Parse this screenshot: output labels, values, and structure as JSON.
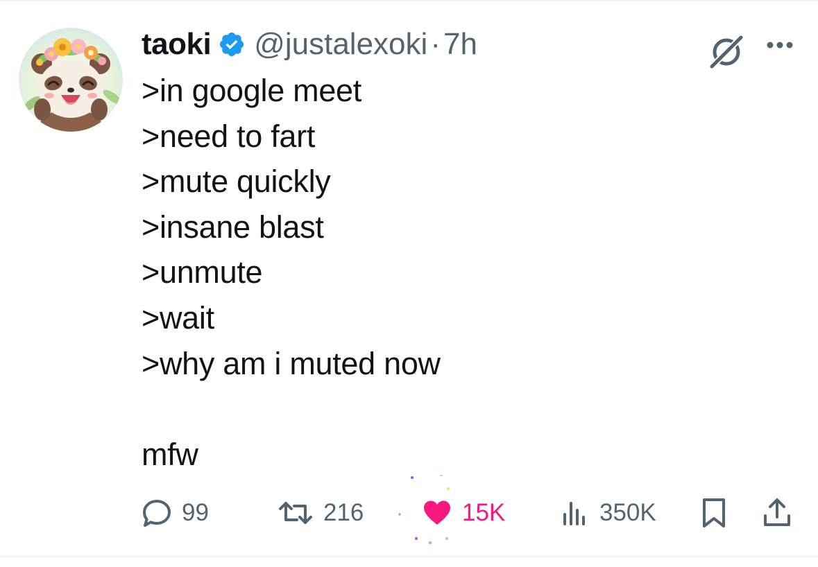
{
  "tweet": {
    "author": {
      "display_name": "taoki",
      "handle": "@justalexoki",
      "verified": true,
      "avatar_icon": "panda-flower-crown-avatar"
    },
    "separator": "·",
    "time": "7h",
    "text_lines": [
      ">in google meet",
      ">need to fart",
      ">mute quickly",
      ">insane blast",
      ">unmute",
      ">wait",
      ">why am i muted now"
    ],
    "closing_line": "mfw",
    "actions": {
      "replies": "99",
      "reposts": "216",
      "likes": "15K",
      "views": "350K"
    },
    "liked": true,
    "icons": [
      "grok-icon",
      "more-icon",
      "reply-icon",
      "repost-icon",
      "heart-icon",
      "views-icon",
      "bookmark-icon",
      "share-icon"
    ],
    "colors": {
      "text": "#0f1419",
      "secondary": "#536471",
      "verified": "#1d9bf0",
      "like": "#f91880"
    }
  }
}
